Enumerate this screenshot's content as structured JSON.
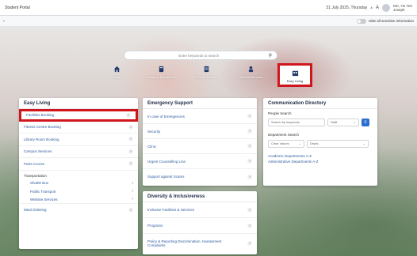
{
  "topbar": {
    "title": "Student Portal",
    "date": "31 July 2025, Thursday",
    "text_size": "A",
    "text_size_small": "A",
    "user_name": "MC, Ho Yee",
    "user_role": "Joseph"
  },
  "subbar": {
    "toggle_label": "Hide all sensitive information"
  },
  "search": {
    "placeholder": "Enter keywords to search"
  },
  "quicknav": {
    "items": [
      {
        "label": "Home",
        "icon": "home-icon"
      },
      {
        "label": "Learning Experience",
        "icon": "book-icon"
      },
      {
        "label": "Finance Related",
        "icon": "document-icon"
      },
      {
        "label": "Student Services",
        "icon": "people-icon"
      },
      {
        "label": "Easy Living",
        "icon": "building-icon",
        "selected": true
      }
    ]
  },
  "easy_living": {
    "title": "Easy Living",
    "items": [
      {
        "label": "Facilities Booking"
      },
      {
        "label": "Fitness Centre Booking"
      },
      {
        "label": "Library Room Booking"
      },
      {
        "label": "Campus Services"
      },
      {
        "label": "Parts Access"
      }
    ],
    "transport_label": "Transportation",
    "transport_items": [
      {
        "label": "Shuttle Bus"
      },
      {
        "label": "Public Transport"
      },
      {
        "label": "Website Services"
      }
    ],
    "last_item": "Meal Ordering"
  },
  "emergency": {
    "title": "Emergency Support",
    "items": [
      {
        "label": "In case of Emergencies"
      },
      {
        "label": "Security"
      },
      {
        "label": "Clinic"
      },
      {
        "label": "Urgent Counselling Line"
      },
      {
        "label": "Support against Scams"
      }
    ]
  },
  "diversity": {
    "title": "Diversity & Inclusiveness",
    "items": [
      {
        "label": "Inclusive Facilities & Services"
      },
      {
        "label": "Programs"
      },
      {
        "label": "Policy & Reporting Discrimination, Harassment Complaints"
      }
    ]
  },
  "directory": {
    "title": "Communication Directory",
    "people_search_label": "People Search",
    "people_placeholder": "Search by keywords",
    "people_filter": "Staff",
    "department_search_label": "Department Search",
    "dept_filter_1": "Clear Values",
    "dept_filter_2": "Depts",
    "link_academic": "Academic Departments A-Z",
    "link_admin": "Administrative Departments A-Z"
  },
  "colors": {
    "highlight": "#d0161d",
    "link": "#2c5aa0",
    "button": "#2c6fcf"
  }
}
